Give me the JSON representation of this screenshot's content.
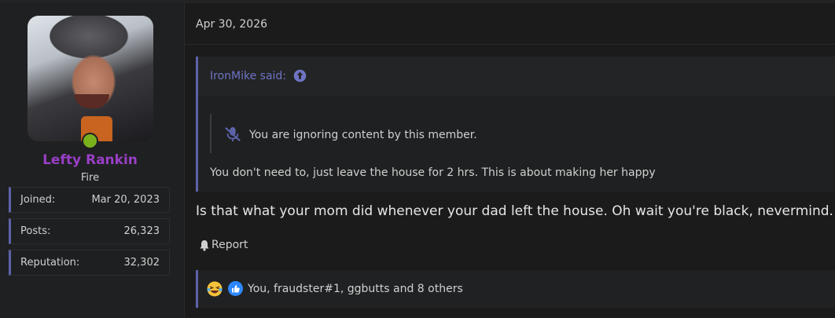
{
  "user": {
    "name": "Lefty Rankin",
    "title": "Fire",
    "stats": [
      {
        "label": "Joined:",
        "value": "Mar 20, 2023"
      },
      {
        "label": "Posts:",
        "value": "26,323"
      },
      {
        "label": "Reputation:",
        "value": "32,302"
      }
    ],
    "online": true
  },
  "post": {
    "date": "Apr 30, 2026",
    "quote": {
      "author_line": "IronMike said:",
      "ignored_notice": "You are ignoring content by this member.",
      "body": "You don't need to, just leave the house for 2 hrs. This is about making her happy"
    },
    "message": "Is that what your mom did whenever your dad left the house. Oh wait you're black, nevermind.",
    "report_label": "Report",
    "reactions_text": "You, fraudster#1, ggbutts and 8 others"
  },
  "colors": {
    "background": "#1b1b1c",
    "username": "#9a3fc7",
    "accent": "#5c63a8",
    "quote_author": "#6e74c5",
    "online": "#7bb21c"
  },
  "icons": {
    "online": "online-indicator",
    "quote_jump": "arrow-up-circle-icon",
    "ignored": "muted-microphone-icon",
    "report": "bell-icon",
    "reactions": [
      "laughing-emoji-icon",
      "thumbs-up-icon"
    ]
  }
}
